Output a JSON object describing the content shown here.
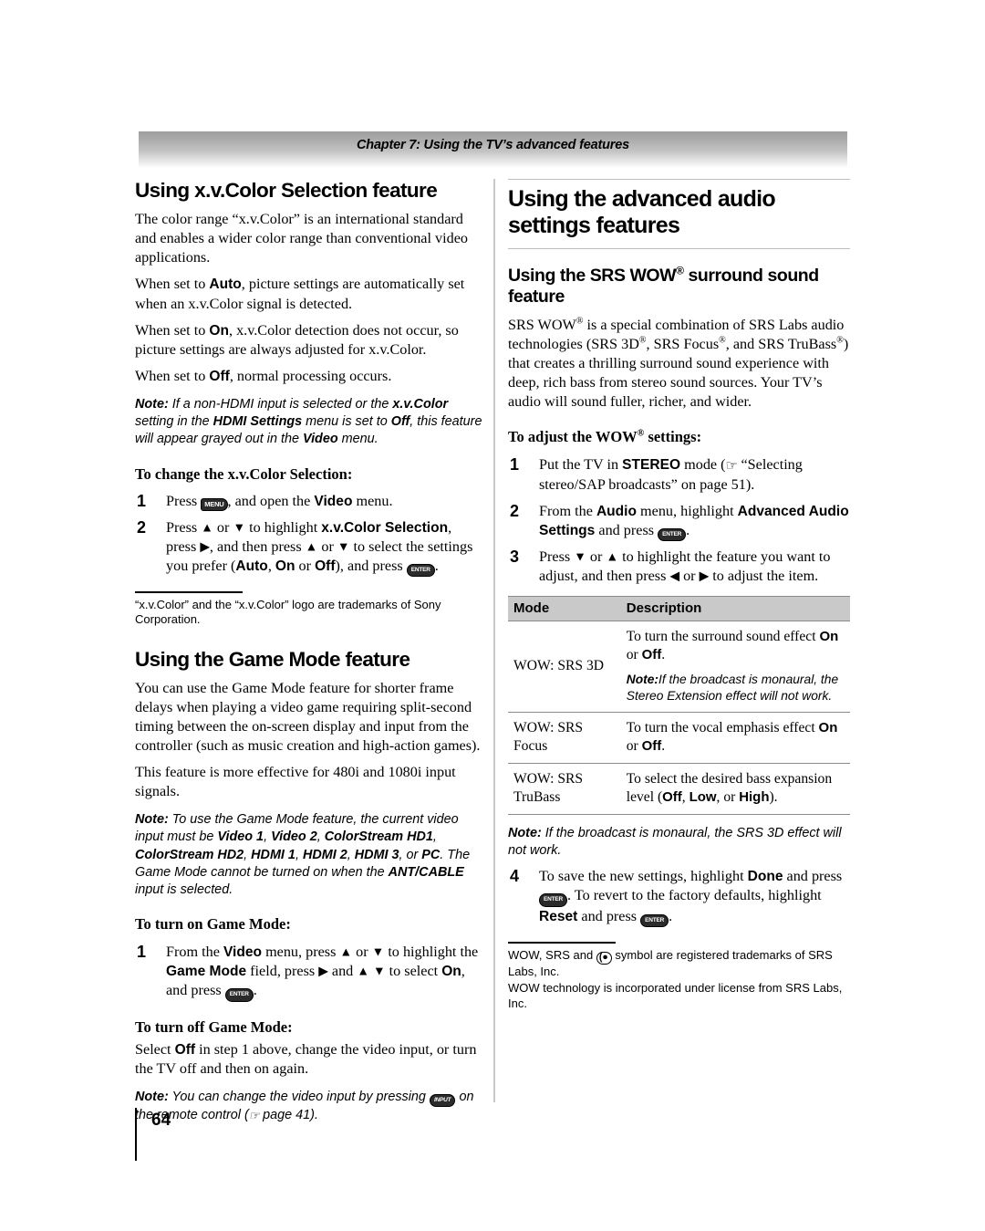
{
  "document": {
    "chapter_header": "Chapter 7: Using the TV’s advanced features",
    "page_number": "64"
  },
  "left_column": {
    "section1": {
      "heading": "Using x.v.Color Selection feature",
      "paragraphs": [
        "The color range “x.v.Color” is an international standard and enables a wider color range than conventional video applications.",
        "When set to Auto, picture settings are automatically set when an x.v.Color signal is detected.",
        "When set to On, x.v.Color detection does not occur, so picture settings are always adjusted for x.v.Color.",
        "When set to Off, normal processing occurs."
      ],
      "note": "Note: If a non-HDMI input is selected or the x.v.Color setting in the HDMI Settings menu is set to Off, this feature will appear grayed out in the Video menu.",
      "procedure_title": "To change the x.v.Color Selection:",
      "steps": [
        {
          "num": "1",
          "text": "Press MENU, and open the Video menu."
        },
        {
          "num": "2",
          "text": "Press ▲ or ▼ to highlight x.v.Color Selection, press ▶, and then press ▲ or ▼ to select the settings you prefer (Auto, On or Off), and press ENTER."
        }
      ],
      "footnote": "“x.v.Color” and the “x.v.Color” logo are trademarks of Sony Corporation."
    },
    "section2": {
      "heading": "Using the Game Mode feature",
      "paragraphs": [
        "You can use the Game Mode feature for shorter frame delays when playing a video game requiring split-second timing between the on-screen display and input from the controller (such as music creation and high-action games).",
        "This feature is more effective for 480i and 1080i input signals."
      ],
      "note": "Note: To use the Game Mode feature, the current video input must be Video 1, Video 2, ColorStream HD1, ColorStream HD2, HDMI 1, HDMI 2, HDMI 3, or PC. The Game Mode cannot be turned on when the ANT/CABLE input is selected.",
      "on_title": "To turn on Game Mode:",
      "on_steps": [
        {
          "num": "1",
          "text": "From the Video menu, press ▲ or ▼ to highlight the Game Mode field, press ▶ and ▲▼ to select On, and press ENTER."
        }
      ],
      "off_title": "To turn off Game Mode:",
      "off_text": "Select Off in step 1 above, change the video input, or turn the TV off and then on again.",
      "off_note": "Note: You can change the video input by pressing INPUT on the remote control (☞ page 41)."
    }
  },
  "right_column": {
    "main_heading": "Using the advanced audio settings features",
    "section": {
      "heading": "Using the SRS WOW® surround sound feature",
      "paragraph": "SRS WOW® is a special combination of SRS Labs audio technologies (SRS 3D®, SRS Focus®, and SRS TruBass®) that creates a thrilling surround sound experience with deep, rich bass from stereo sound sources. Your TV’s audio will sound fuller, richer, and wider.",
      "procedure_title": "To adjust the WOW® settings:",
      "steps": [
        {
          "num": "1",
          "text": "Put the TV in STEREO mode (☞ “Selecting stereo/SAP broadcasts” on page 51)."
        },
        {
          "num": "2",
          "text": "From the Audio menu, highlight Advanced Audio Settings and press ENTER."
        },
        {
          "num": "3",
          "text": "Press ▼ or ▲ to highlight the feature you want to adjust, and then press ◀ or ▶ to adjust the item."
        }
      ],
      "table": {
        "headers": [
          "Mode",
          "Description"
        ],
        "rows": [
          {
            "mode": "WOW: SRS 3D",
            "description": "To turn the surround sound effect On or Off.",
            "note": "Note:If the broadcast is monaural, the Stereo Extension effect will not work."
          },
          {
            "mode": "WOW: SRS Focus",
            "description": "To turn the vocal emphasis effect On or Off.",
            "note": ""
          },
          {
            "mode": "WOW: SRS TruBass",
            "description": "To select the desired bass expansion level (Off, Low, or High).",
            "note": ""
          }
        ]
      },
      "table_note": "Note: If the broadcast is monaural, the SRS 3D effect will not work.",
      "step4": {
        "num": "4",
        "text": "To save the new settings, highlight Done and press ENTER. To revert to the factory defaults, highlight Reset and press ENTER."
      },
      "footnotes": [
        "WOW, SRS and (●) symbol are registered trademarks of SRS Labs, Inc.",
        "WOW technology is incorporated under license from SRS Labs, Inc."
      ]
    }
  },
  "icons": {
    "menu_key": "MENU",
    "enter_key": "ENTER",
    "input_key": "INPUT",
    "pointing_hand": "☞",
    "arrow_up": "▲",
    "arrow_down": "▼",
    "arrow_left": "◀",
    "arrow_right": "▶"
  },
  "colors": {
    "header_bar_top": "#9e9e9e",
    "header_bar_bottom": "#ffffff",
    "table_header_bg": "#c9c9c9",
    "rule": "#8a8a8a",
    "divider": "#c9c9c9"
  }
}
